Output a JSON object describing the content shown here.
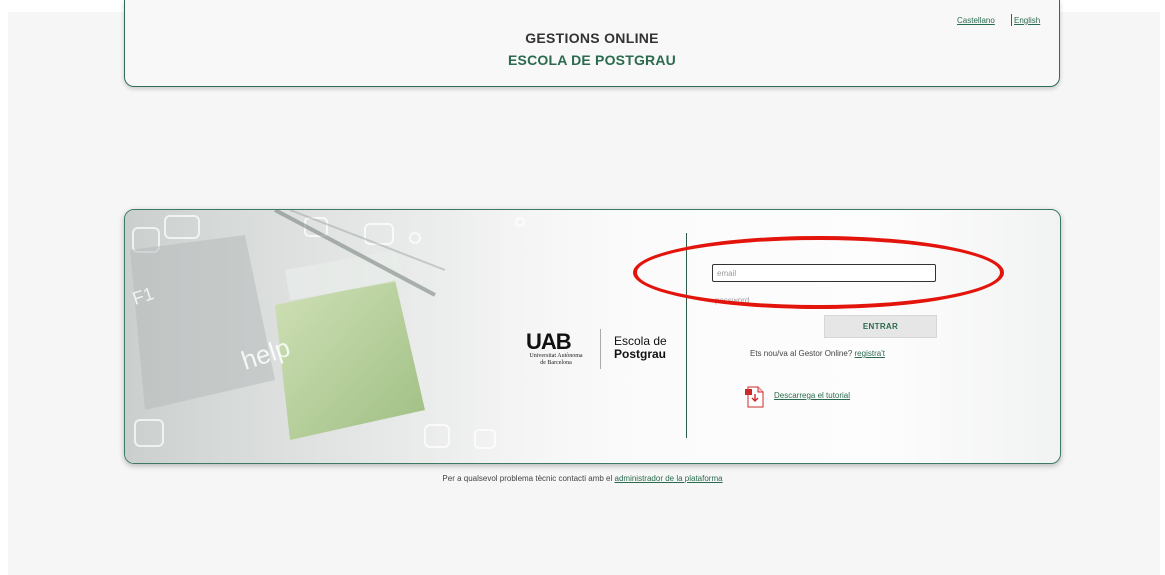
{
  "header": {
    "title": "GESTIONS ONLINE",
    "subtitle": "ESCOLA DE POSTGRAU",
    "languages": [
      "Castellano",
      "English"
    ]
  },
  "decoration": {
    "key_label_help": "help",
    "key_label_f1": "F1"
  },
  "logo": {
    "mark": "UAB",
    "institution_line1": "Universitat Autònoma",
    "institution_line2": "de Barcelona",
    "school_line1": "Escola de",
    "school_line2": "Postgrau"
  },
  "login": {
    "email_placeholder": "email",
    "password_placeholder": "password",
    "enter_label": "ENTRAR",
    "register_prompt": "Ets nou/va al Gestor Online?",
    "register_link": "registra't",
    "tutorial_link": "Descarrega el tutorial"
  },
  "footer": {
    "text": "Per a qualsevol problema tècnic contacti amb el",
    "link": "administrador de la plataforma"
  },
  "colors": {
    "accent_green": "#2a6a4e",
    "annotation_red": "#e3140c",
    "page_background": "#f6f6f6"
  }
}
